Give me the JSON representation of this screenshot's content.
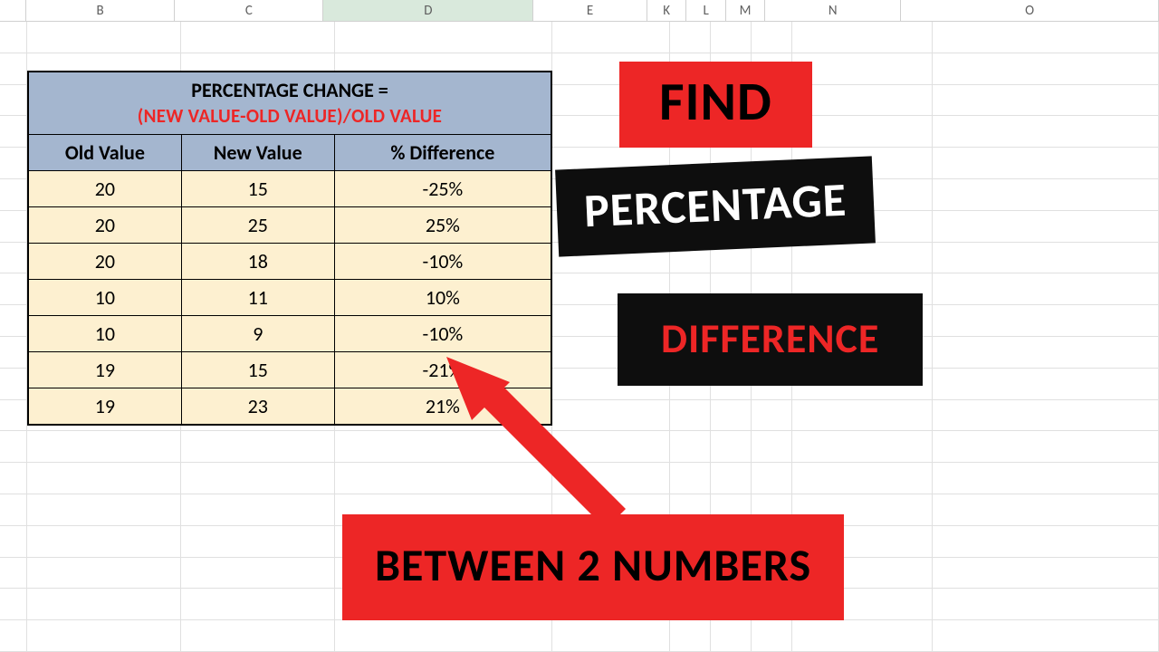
{
  "columns": [
    "B",
    "C",
    "D",
    "E",
    "K",
    "L",
    "M",
    "N",
    "O"
  ],
  "formula": {
    "line1": "PERCENTAGE CHANGE =",
    "line2": "(NEW VALUE-OLD VALUE)/OLD VALUE"
  },
  "headers": {
    "old": "Old Value",
    "new": "New Value",
    "pct": "% Difference"
  },
  "rows": [
    {
      "old": "20",
      "new": "15",
      "pct": "-25%"
    },
    {
      "old": "20",
      "new": "25",
      "pct": "25%"
    },
    {
      "old": "20",
      "new": "18",
      "pct": "-10%"
    },
    {
      "old": "10",
      "new": "11",
      "pct": "10%"
    },
    {
      "old": "10",
      "new": "9",
      "pct": "-10%"
    },
    {
      "old": "19",
      "new": "15",
      "pct": "-21%"
    },
    {
      "old": "19",
      "new": "23",
      "pct": "21%"
    }
  ],
  "banners": {
    "find": "FIND",
    "percentage": "PERCENTAGE",
    "difference": "DIFFERENCE",
    "between": "BETWEEN 2 NUMBERS"
  },
  "colors": {
    "red": "#ed2626",
    "black": "#0e0e0e",
    "table_header": "#a4b6cf",
    "table_cell": "#fdf0d0"
  },
  "chart_data": {
    "type": "table",
    "title": "PERCENTAGE CHANGE = (NEW VALUE-OLD VALUE)/OLD VALUE",
    "columns": [
      "Old Value",
      "New Value",
      "% Difference"
    ],
    "rows": [
      [
        20,
        15,
        "-25%"
      ],
      [
        20,
        25,
        "25%"
      ],
      [
        20,
        18,
        "-10%"
      ],
      [
        10,
        11,
        "10%"
      ],
      [
        10,
        9,
        "-10%"
      ],
      [
        19,
        15,
        "-21%"
      ],
      [
        19,
        23,
        "21%"
      ]
    ]
  }
}
